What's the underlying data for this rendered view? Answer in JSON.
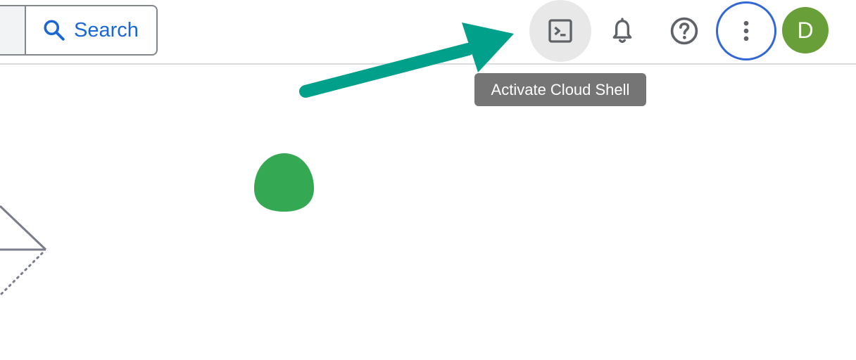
{
  "header": {
    "search": {
      "label": "Search",
      "input_placeholder": ""
    },
    "actions": [
      {
        "id": "cloud-shell",
        "icon": "terminal-icon",
        "state": "hovered"
      },
      {
        "id": "notifications",
        "icon": "bell-icon"
      },
      {
        "id": "help",
        "icon": "help-icon"
      },
      {
        "id": "more",
        "icon": "more-vertical-icon",
        "highlight": "circled"
      }
    ],
    "avatar": {
      "initial": "D",
      "color": "#689f38"
    }
  },
  "tooltip": {
    "text": "Activate Cloud Shell"
  },
  "annotation": {
    "arrow_color": "#00a08a",
    "circle_color": "#3367d6"
  },
  "colors": {
    "accent": "#1967d2",
    "icon": "#5f6368",
    "hover_bg": "#e8e8e8",
    "divider": "#dadce0",
    "decor_green": "#34a853"
  }
}
